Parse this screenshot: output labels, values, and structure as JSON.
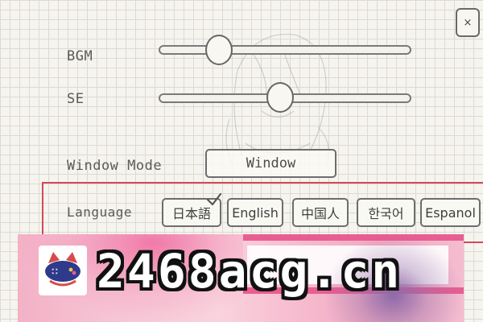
{
  "close_button": {
    "label": "×"
  },
  "settings": {
    "bgm": {
      "label": "BGM",
      "value": 0.24
    },
    "se": {
      "label": "SE",
      "value": 0.48
    },
    "window_mode": {
      "label": "Window Mode",
      "value": "Window"
    },
    "language": {
      "label": "Language",
      "selected": "日本語",
      "options": [
        "日本語",
        "English",
        "中国人",
        "한국어",
        "Espanol"
      ]
    }
  },
  "banner": {
    "text": "2468acg.cn",
    "logo_icon": "game-controller-cat-icon"
  },
  "colors": {
    "highlight_border": "#d24a5a",
    "banner_pink": "#f3b1c6",
    "banner_accent": "#e85e91"
  }
}
